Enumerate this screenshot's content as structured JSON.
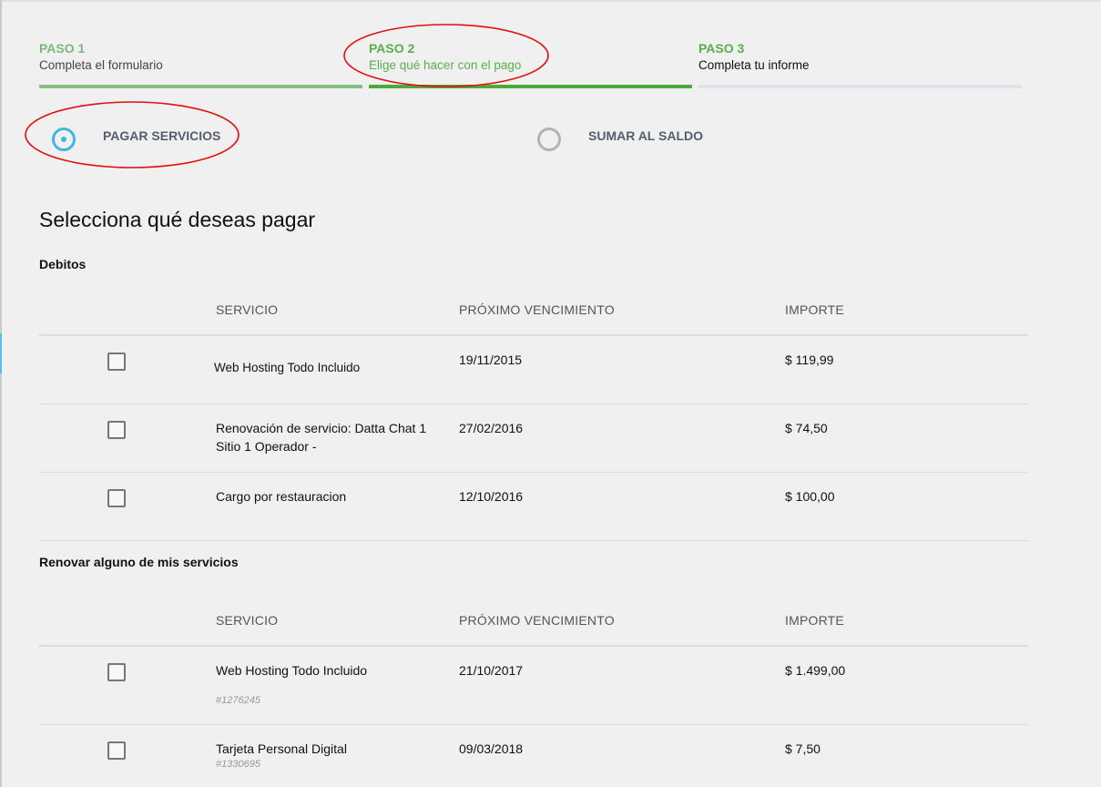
{
  "steps": [
    {
      "label": "PASO 1",
      "desc": "Completa el formulario"
    },
    {
      "label": "PASO 2",
      "desc": "Elige qué hacer con el pago"
    },
    {
      "label": "PASO 3",
      "desc": "Completa tu informe"
    }
  ],
  "options": {
    "pagar": {
      "label": "PAGAR SERVICIOS",
      "selected": true
    },
    "sumar": {
      "label": "SUMAR AL SALDO",
      "selected": false
    }
  },
  "heading": "Selecciona qué deseas pagar",
  "columns": {
    "service": "SERVICIO",
    "due": "PRÓXIMO VENCIMIENTO",
    "amount": "IMPORTE"
  },
  "debitos": {
    "title": "Debitos",
    "rows": [
      {
        "service": "Web Hosting Todo Incluido",
        "due": "19/11/2015",
        "amount": "$ 119,99",
        "checked": false
      },
      {
        "service": "Renovación de servicio: Datta Chat 1 Sitio 1 Operador -",
        "due": "27/02/2016",
        "amount": "$ 74,50",
        "checked": false
      },
      {
        "service": "Cargo por restauracion",
        "due": "12/10/2016",
        "amount": "$ 100,00",
        "checked": false
      }
    ]
  },
  "renovar": {
    "title": "Renovar alguno de mis servicios",
    "rows": [
      {
        "service": "Web Hosting Todo Incluido",
        "id": "#1276245",
        "due": "21/10/2017",
        "amount": "$ 1.499,00",
        "checked": false
      },
      {
        "service": "Tarjeta Personal Digital",
        "id": "#1330695",
        "due": "09/03/2018",
        "amount": "$ 7,50",
        "checked": false
      }
    ]
  },
  "colors": {
    "accent": "#3fb6e0",
    "step_green": "#5aad4b",
    "annotation_red": "#e01010"
  }
}
